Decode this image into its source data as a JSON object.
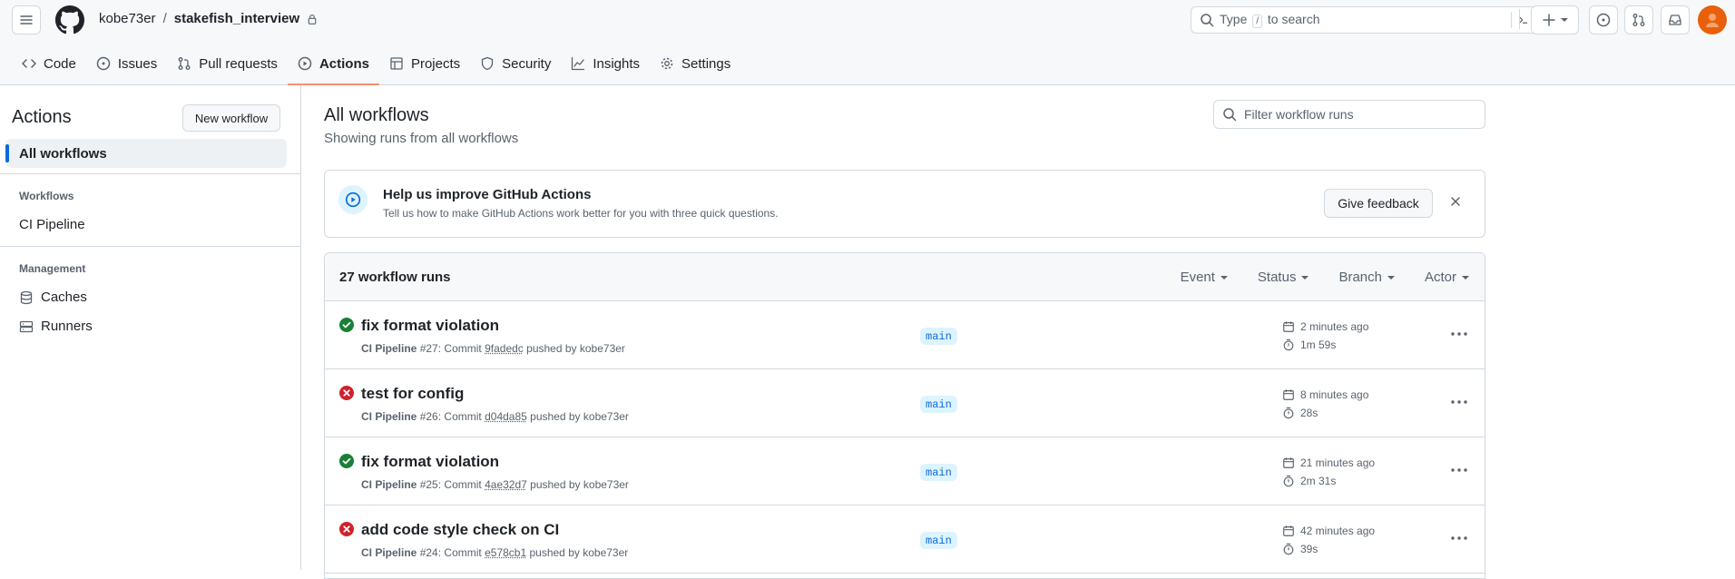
{
  "header": {
    "owner": "kobe73er",
    "separator": "/",
    "repo": "stakefish_interview",
    "search_prefix": "Type",
    "search_key": "/",
    "search_suffix": "to search"
  },
  "tabs": [
    {
      "label": "Code",
      "icon": "code-icon"
    },
    {
      "label": "Issues",
      "icon": "issue-icon"
    },
    {
      "label": "Pull requests",
      "icon": "pull-request-icon"
    },
    {
      "label": "Actions",
      "icon": "play-icon",
      "active": true
    },
    {
      "label": "Projects",
      "icon": "table-icon"
    },
    {
      "label": "Security",
      "icon": "shield-icon"
    },
    {
      "label": "Insights",
      "icon": "graph-icon"
    },
    {
      "label": "Settings",
      "icon": "gear-icon"
    }
  ],
  "sidebar": {
    "title": "Actions",
    "new_workflow": "New workflow",
    "all_workflows": "All workflows",
    "workflows_heading": "Workflows",
    "workflows": [
      "CI Pipeline"
    ],
    "management_heading": "Management",
    "management": [
      {
        "label": "Caches",
        "icon": "database-icon"
      },
      {
        "label": "Runners",
        "icon": "server-icon"
      }
    ]
  },
  "main": {
    "title": "All workflows",
    "subtitle": "Showing runs from all workflows",
    "filter_placeholder": "Filter workflow runs"
  },
  "banner": {
    "title": "Help us improve GitHub Actions",
    "text": "Tell us how to make GitHub Actions work better for you with three quick questions.",
    "button": "Give feedback"
  },
  "runs": {
    "count_label": "27 workflow runs",
    "filters": [
      "Event",
      "Status",
      "Branch",
      "Actor"
    ],
    "items": [
      {
        "status": "success",
        "title": "fix format violation",
        "workflow": "CI Pipeline",
        "number": "#27",
        "sha": "9fadedc",
        "actor": "kobe73er",
        "branch": "main",
        "when": "2 minutes ago",
        "duration": "1m 59s"
      },
      {
        "status": "failure",
        "title": "test for config",
        "workflow": "CI Pipeline",
        "number": "#26",
        "sha": "d04da85",
        "actor": "kobe73er",
        "branch": "main",
        "when": "8 minutes ago",
        "duration": "28s"
      },
      {
        "status": "success",
        "title": "fix format violation",
        "workflow": "CI Pipeline",
        "number": "#25",
        "sha": "4ae32d7",
        "actor": "kobe73er",
        "branch": "main",
        "when": "21 minutes ago",
        "duration": "2m 31s"
      },
      {
        "status": "failure",
        "title": "add code style check on CI",
        "workflow": "CI Pipeline",
        "number": "#24",
        "sha": "e578cb1",
        "actor": "kobe73er",
        "branch": "main",
        "when": "42 minutes ago",
        "duration": "39s"
      }
    ],
    "meta_commit": "Commit",
    "meta_pushed": "pushed by"
  },
  "colors": {
    "accent": "#0969da",
    "success": "#1a7f37",
    "failure": "#cf222e",
    "tab_underline": "#fd8c73",
    "avatar": "#e8600c"
  }
}
